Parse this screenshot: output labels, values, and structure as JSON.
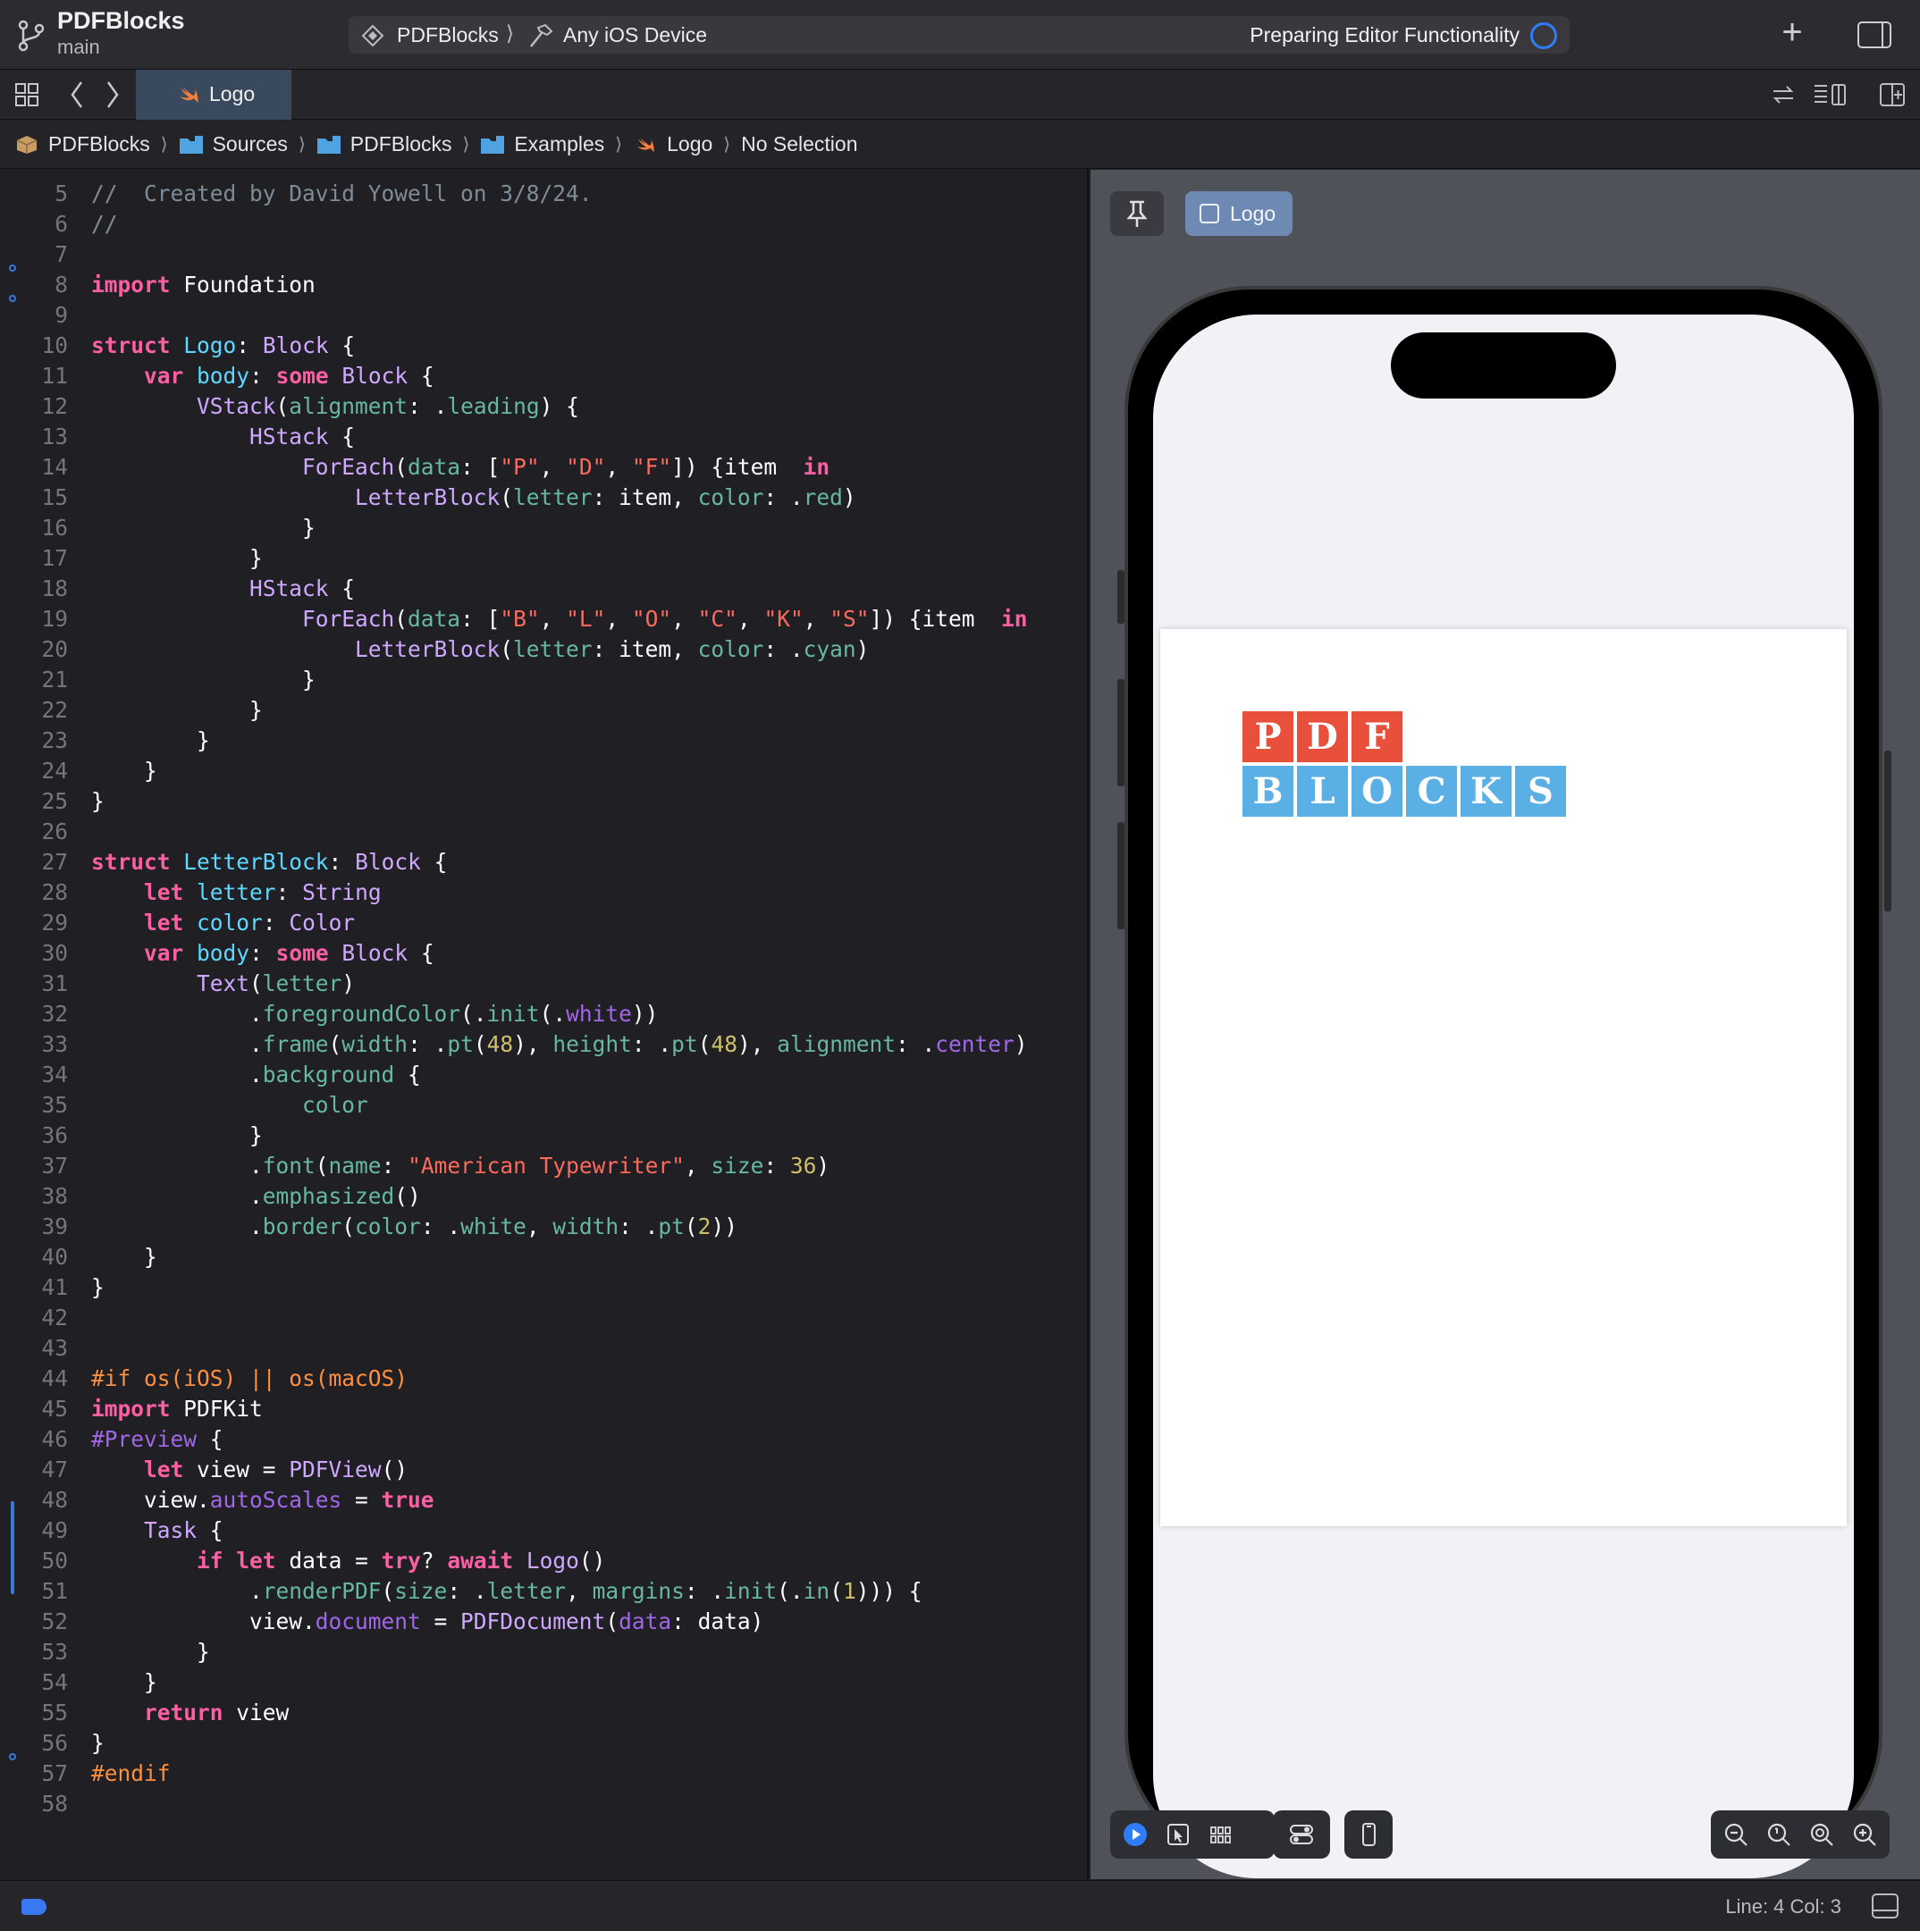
{
  "titlebar": {
    "project": "PDFBlocks",
    "branch": "main",
    "scheme": "PDFBlocks",
    "scheme_sep": "⟩",
    "device": "Any iOS Device",
    "status": "Preparing Editor Functionality"
  },
  "tabbar": {
    "active_tab": "Logo"
  },
  "breadcrumb": {
    "items": [
      "PDFBlocks",
      "Sources",
      "PDFBlocks",
      "Examples",
      "Logo",
      "No Selection"
    ],
    "sep": "⟩"
  },
  "editor": {
    "line_numbers": [
      "5",
      "6",
      "7",
      "8",
      "9",
      "10",
      "11",
      "12",
      "13",
      "14",
      "15",
      "16",
      "17",
      "18",
      "19",
      "20",
      "21",
      "22",
      "23",
      "24",
      "25",
      "26",
      "27",
      "28",
      "29",
      "30",
      "31",
      "32",
      "33",
      "34",
      "35",
      "36",
      "37",
      "38",
      "39",
      "40",
      "41",
      "42",
      "43",
      "44",
      "45",
      "46",
      "47",
      "48",
      "49",
      "50",
      "51",
      "52",
      "53",
      "54",
      "55",
      "56",
      "57",
      "58"
    ]
  },
  "preview": {
    "tab_label": "Logo",
    "logo_top": [
      "P",
      "D",
      "F"
    ],
    "logo_bottom": [
      "B",
      "L",
      "O",
      "C",
      "K",
      "S"
    ],
    "colors": {
      "red": "#e8503c",
      "cyan": "#5aafe4"
    }
  },
  "statusbar": {
    "position": "Line: 4  Col: 3"
  },
  "icons": [
    "branch-icon",
    "scheme-icon",
    "hammer-icon",
    "plus-icon",
    "inspector-icon",
    "grid-icon",
    "back-chevron-icon",
    "forward-chevron-icon",
    "swift-icon",
    "folder-icon",
    "package-icon",
    "pin-icon",
    "play-icon",
    "select-icon",
    "variants-icon",
    "settings-icon",
    "device-icon",
    "zoom-out-icon",
    "zoom-fit-icon",
    "zoom-actual-icon",
    "zoom-in-icon"
  ]
}
